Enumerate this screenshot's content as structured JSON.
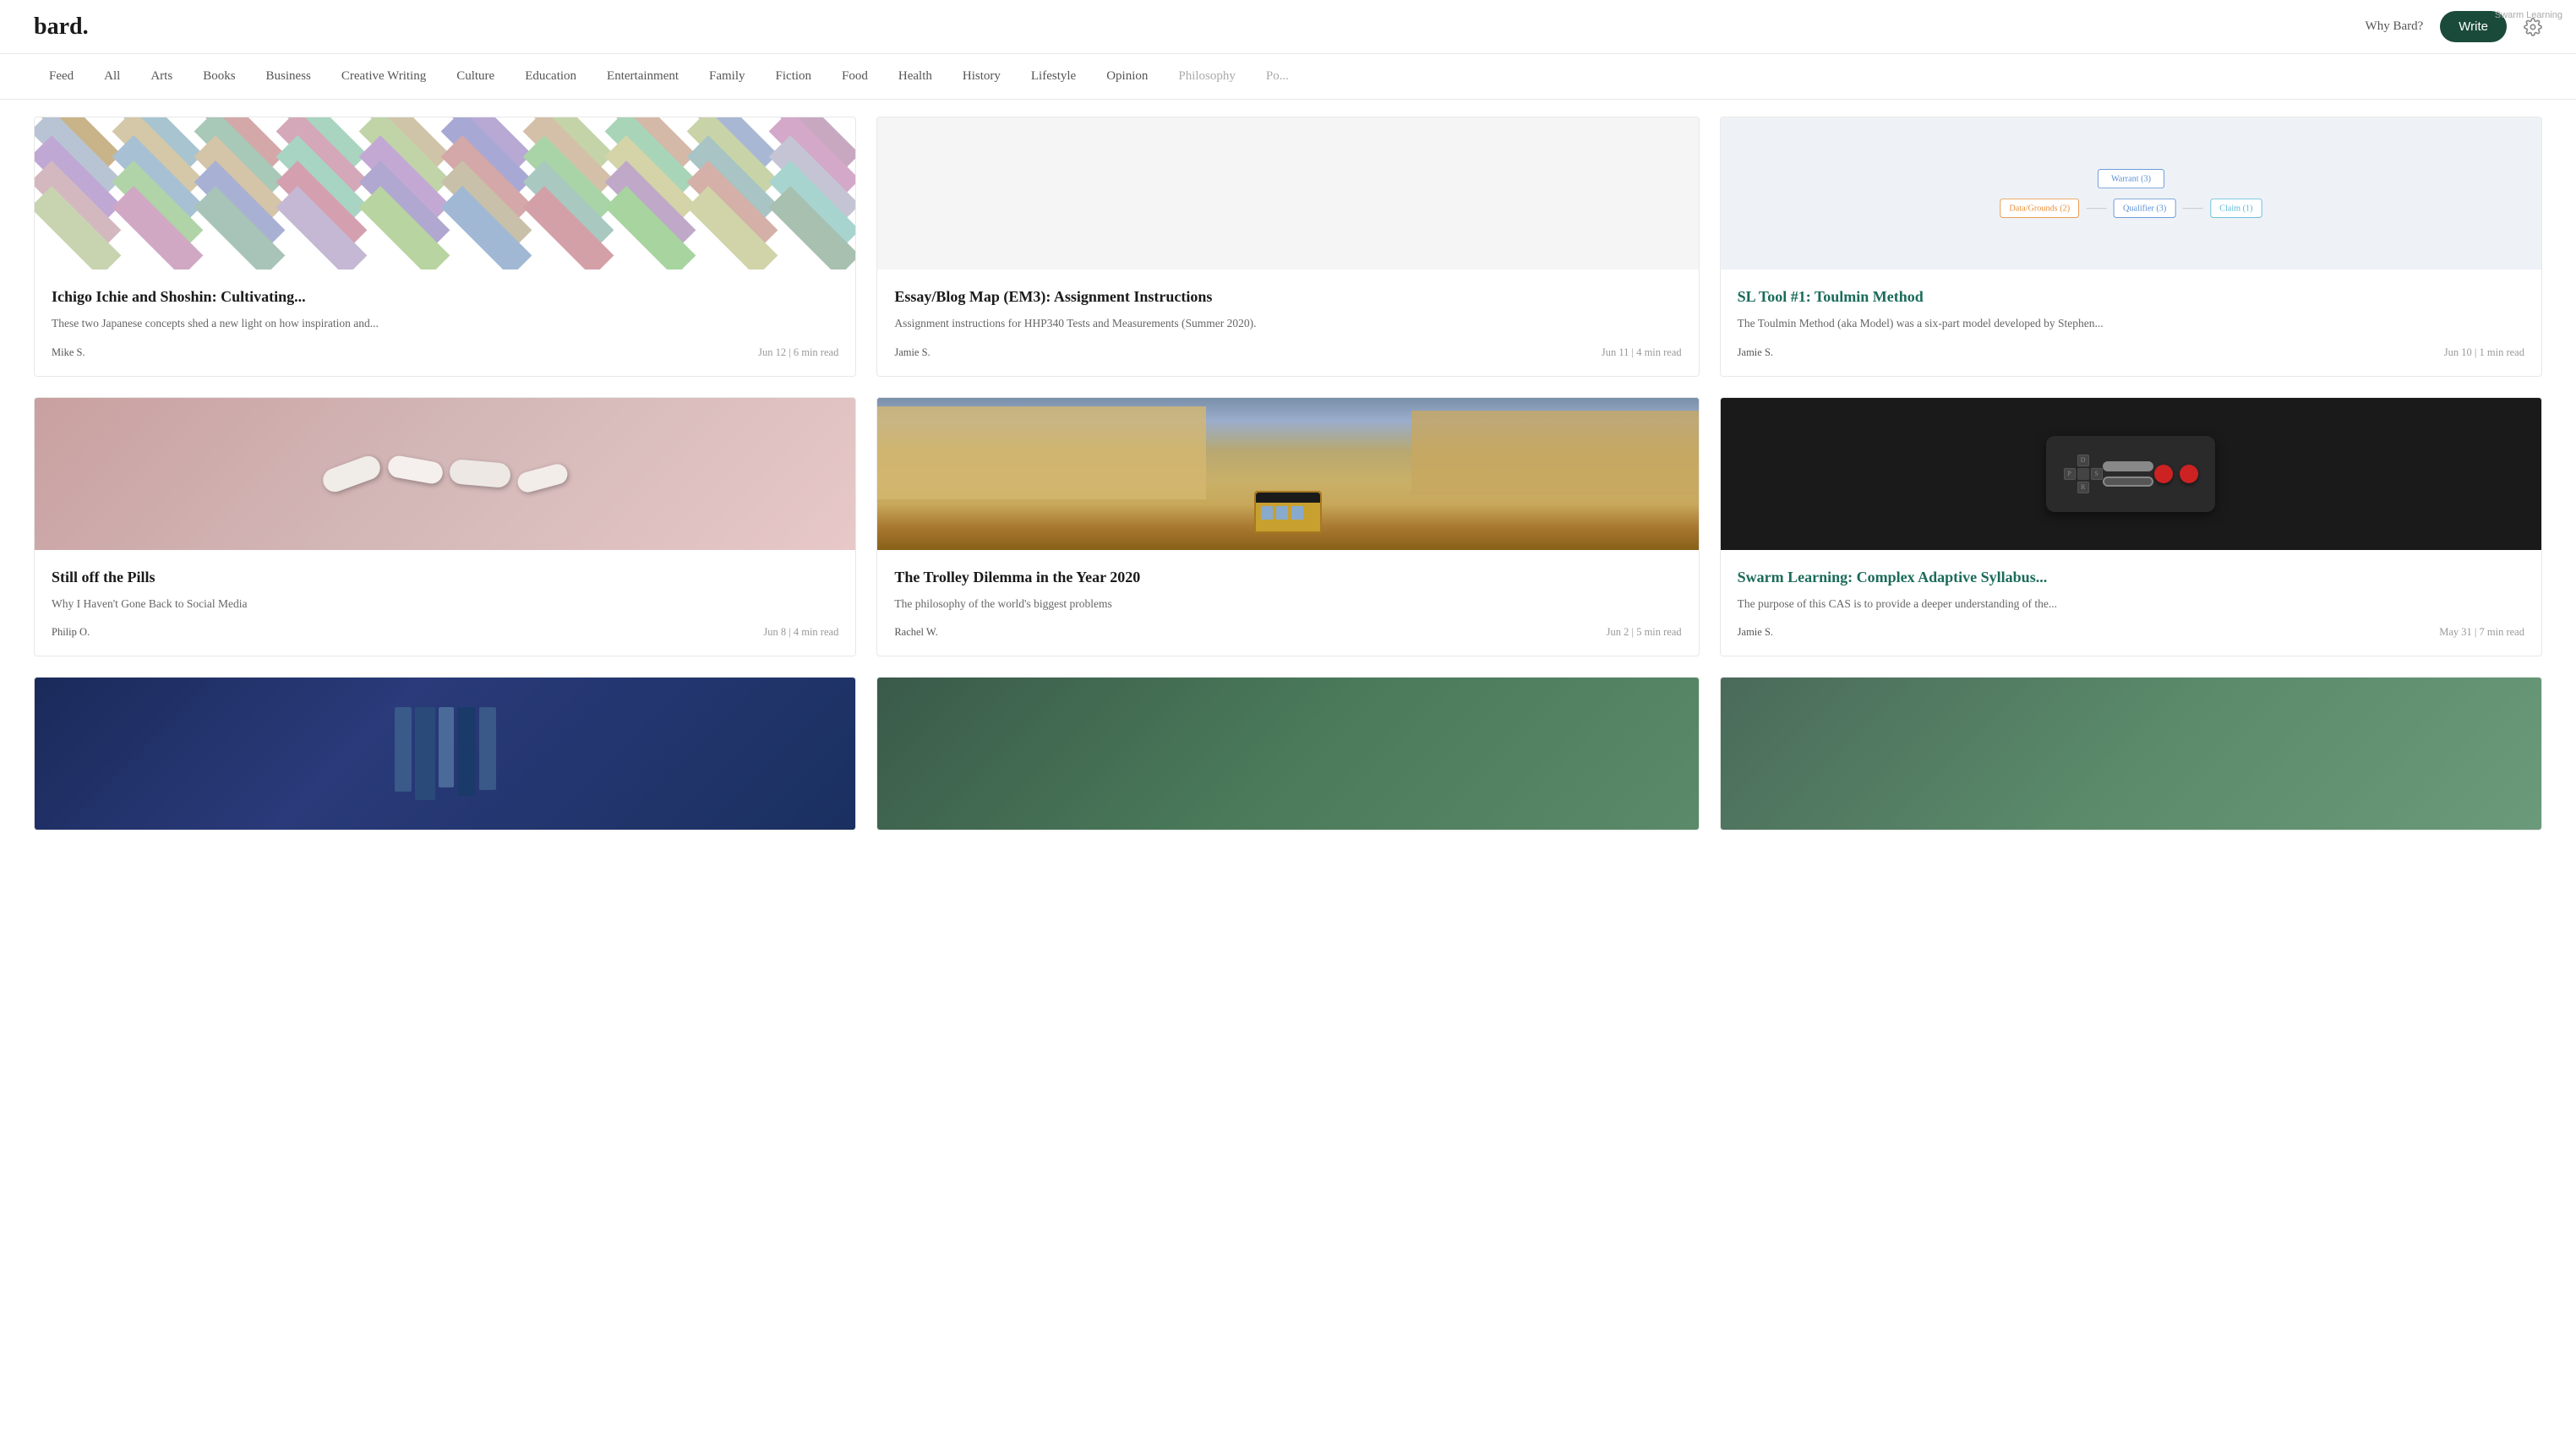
{
  "header": {
    "logo": "bard.",
    "why_bard_label": "Why Bard?",
    "write_label": "Write"
  },
  "nav": {
    "items": [
      {
        "id": "feed",
        "label": "Feed",
        "active": false
      },
      {
        "id": "all",
        "label": "All",
        "active": false
      },
      {
        "id": "arts",
        "label": "Arts",
        "active": false
      },
      {
        "id": "books",
        "label": "Books",
        "active": false
      },
      {
        "id": "business",
        "label": "Business",
        "active": false
      },
      {
        "id": "creative-writing",
        "label": "Creative Writing",
        "active": false
      },
      {
        "id": "culture",
        "label": "Culture",
        "active": false
      },
      {
        "id": "education",
        "label": "Education",
        "active": false
      },
      {
        "id": "entertainment",
        "label": "Entertainment",
        "active": false
      },
      {
        "id": "family",
        "label": "Family",
        "active": false
      },
      {
        "id": "fiction",
        "label": "Fiction",
        "active": false
      },
      {
        "id": "food",
        "label": "Food",
        "active": false
      },
      {
        "id": "health",
        "label": "Health",
        "active": false
      },
      {
        "id": "history",
        "label": "History",
        "active": false
      },
      {
        "id": "lifestyle",
        "label": "Lifestyle",
        "active": false
      },
      {
        "id": "opinion",
        "label": "Opinion",
        "active": false
      },
      {
        "id": "philosophy",
        "label": "Philosophy",
        "faded": true
      },
      {
        "id": "po",
        "label": "Po...",
        "faded": true
      }
    ]
  },
  "articles": [
    {
      "id": "ichigo",
      "title": "Ichigo Ichie and Shoshin: Cultivating...",
      "excerpt": "These two Japanese concepts shed a new light on how inspiration and...",
      "author": "Mike S.",
      "date": "Jun 12",
      "read_time": "6 min read",
      "image_type": "tiles"
    },
    {
      "id": "essay-blog",
      "title": "Essay/Blog Map (EM3): Assignment Instructions",
      "excerpt": "Assignment instructions for HHP340 Tests and Measurements (Summer 2020).",
      "author": "Jamie S.",
      "date": "Jun 11",
      "read_time": "4 min read",
      "image_type": "blank"
    },
    {
      "id": "sl-tool",
      "title": "SL Tool #1: Toulmin Method",
      "excerpt": "The Toulmin Method (aka Model) was a six-part model developed by Stephen...",
      "author": "Jamie S.",
      "date": "Jun 10",
      "read_time": "1 min read",
      "image_type": "diagram",
      "title_color": "teal"
    },
    {
      "id": "still-off-pills",
      "title": "Still off the Pills",
      "excerpt": "Why I Haven't Gone Back to Social Media",
      "author": "Philip O.",
      "date": "Jun 8",
      "read_time": "4 min read",
      "image_type": "pills"
    },
    {
      "id": "trolley",
      "title": "The Trolley Dilemma in the Year 2020",
      "excerpt": "The philosophy of the world's biggest problems",
      "author": "Rachel W.",
      "date": "Jun 2",
      "read_time": "5 min read",
      "image_type": "tram"
    },
    {
      "id": "swarm-learning",
      "title": "Swarm Learning: Complex Adaptive Syllabus...",
      "excerpt": "The purpose of this CAS is to provide a deeper understanding of the...",
      "author": "Jamie S.",
      "date": "May 31",
      "read_time": "7 min read",
      "image_type": "nes",
      "title_color": "teal"
    },
    {
      "id": "article7",
      "title": "",
      "excerpt": "",
      "author": "",
      "date": "",
      "read_time": "",
      "image_type": "book"
    },
    {
      "id": "article8",
      "title": "",
      "excerpt": "",
      "author": "",
      "date": "",
      "read_time": "",
      "image_type": "green"
    },
    {
      "id": "article9",
      "title": "",
      "excerpt": "",
      "author": "",
      "date": "",
      "read_time": "",
      "image_type": "green"
    }
  ]
}
